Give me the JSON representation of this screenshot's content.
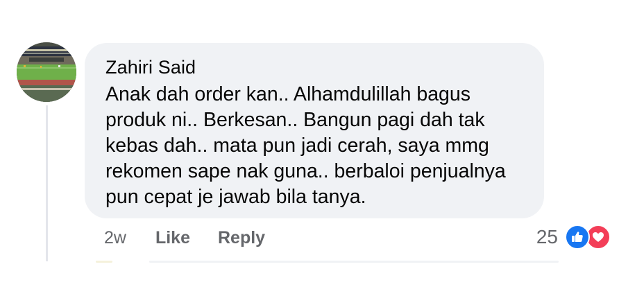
{
  "comment": {
    "author": "Zahiri Said",
    "text": "Anak dah order kan.. Alhamdulillah bagus produk ni.. Berkesan.. Bangun pagi dah tak kebas dah.. mata pun jadi cerah, saya mmg rekomen sape nak guna.. berbaloi penjualnya pun cepat je jawab bila tanya.",
    "timestamp": "2w",
    "like_label": "Like",
    "reply_label": "Reply",
    "reaction_count": "25",
    "reactions": [
      "like-icon",
      "love-icon"
    ]
  },
  "colors": {
    "bubble_bg": "#f0f2f5",
    "text": "#050505",
    "meta_text": "#65676b",
    "like_blue": "#1877f2",
    "love_red": "#f33e58"
  }
}
